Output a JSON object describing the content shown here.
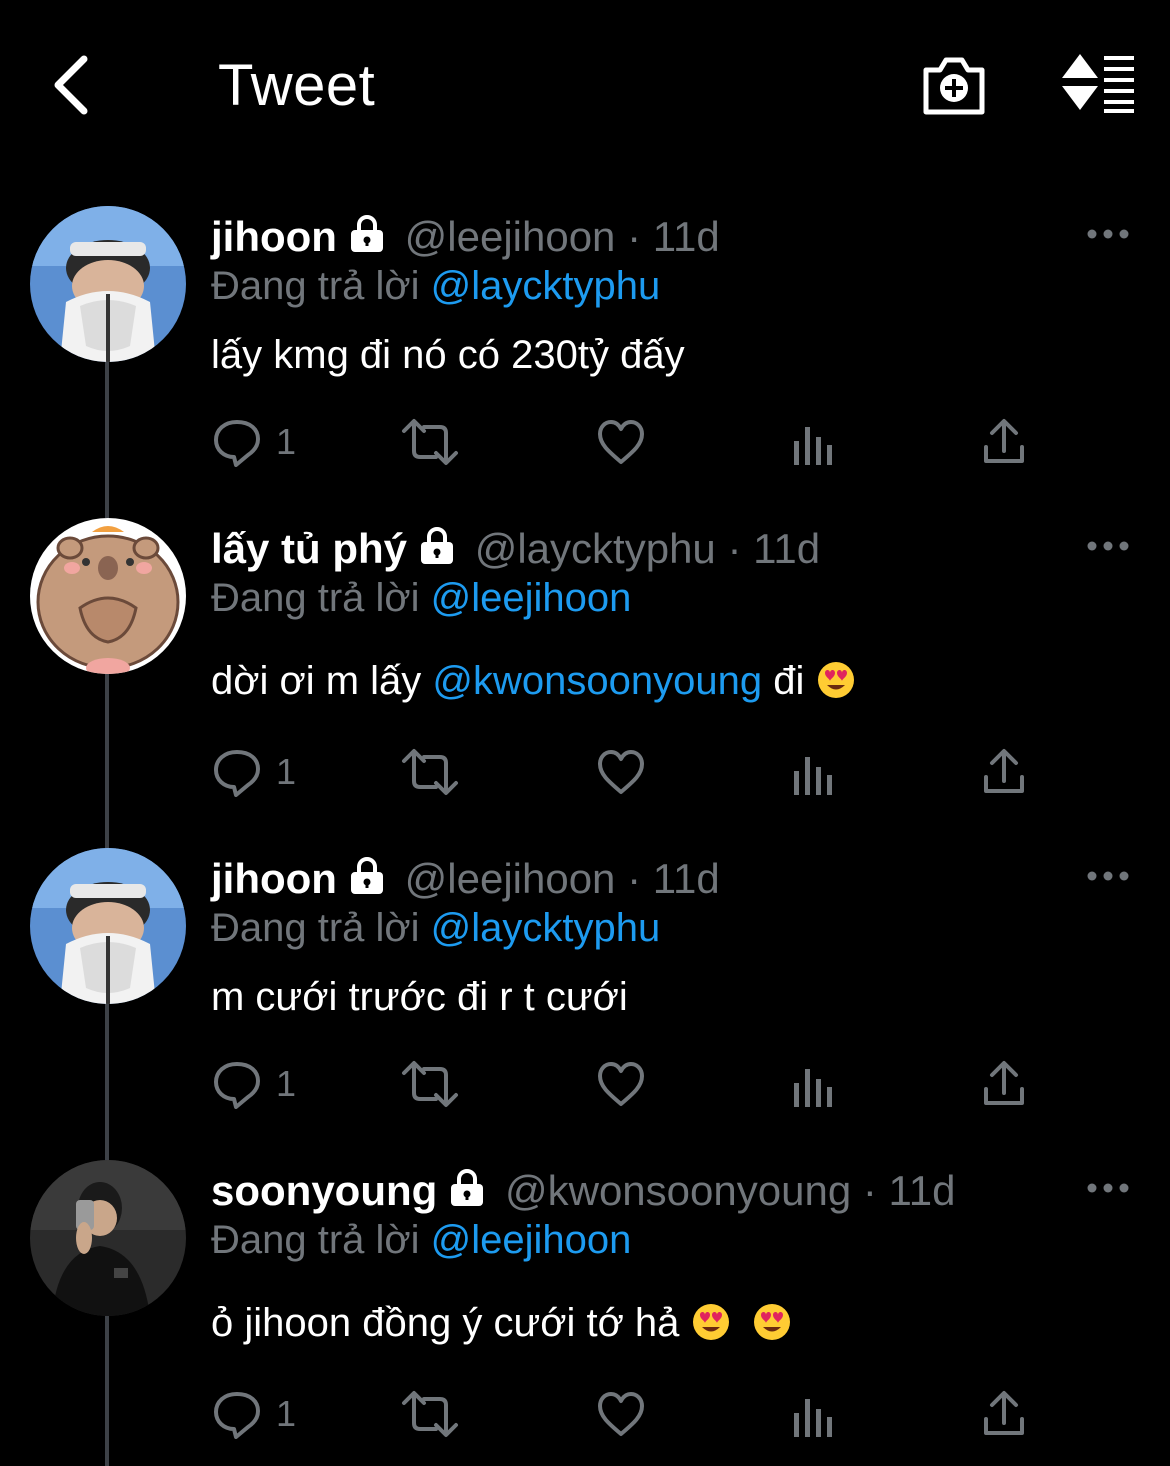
{
  "header": {
    "title": "Tweet",
    "back_icon": "chevron-left-icon",
    "camera_icon": "camera-plus-icon",
    "sort_icon": "sort-icon"
  },
  "colors": {
    "background": "#000000",
    "accent": "#1d9bf0",
    "muted": "#71767b",
    "text": "#ffffff"
  },
  "tweets": [
    {
      "name": "jihoon",
      "handle": "@leejihoon",
      "sep": "·",
      "time": "11d",
      "reply_prefix": "Đang trả lời",
      "reply_to": "@laycktyphu",
      "text": "lấy kmg đi nó có 230tỷ đấy",
      "reply_count": "1"
    },
    {
      "name": "lấy tủ phý",
      "handle": "@laycktyphu",
      "sep": "·",
      "time": "11d",
      "reply_prefix": "Đang trả lời",
      "reply_to": "@leejihoon",
      "text_before": "dời ơi m lấy",
      "text_mention": "@kwonsoonyoung",
      "text_after": "đi",
      "reply_count": "1"
    },
    {
      "name": "jihoon",
      "handle": "@leejihoon",
      "sep": "·",
      "time": "11d",
      "reply_prefix": "Đang trả lời",
      "reply_to": "@laycktyphu",
      "text": "m cưới trước đi r t cưới",
      "reply_count": "1"
    },
    {
      "name": "soonyoung",
      "handle": "@kwonsoonyoung",
      "sep": "·",
      "time": "11d",
      "reply_prefix": "Đang trả lời",
      "reply_to": "@leejihoon",
      "text": "ỏ jihoon đồng ý cưới tớ hả",
      "reply_count": "1"
    }
  ]
}
